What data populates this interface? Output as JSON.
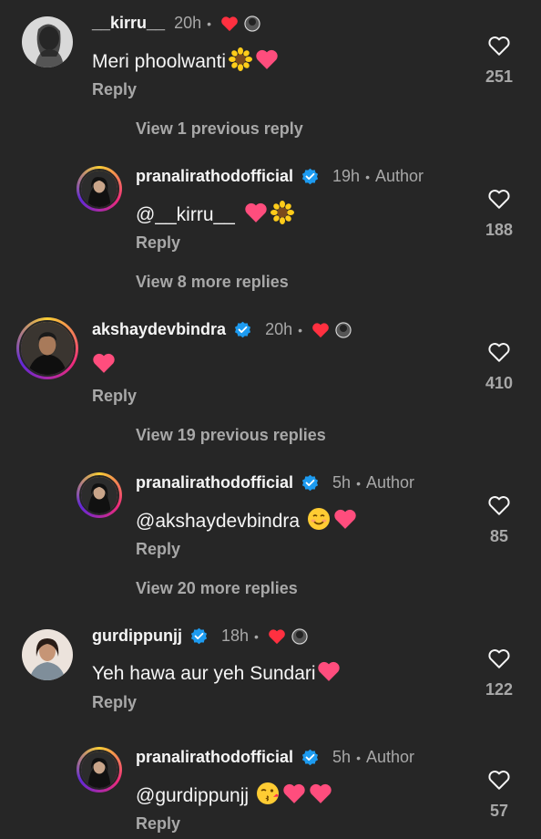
{
  "comments": [
    {
      "username": "__kirru__",
      "time": "20h",
      "text": "Meri phoolwanti",
      "emojis": [
        "sunflower-emoji",
        "pink-heart-emoji"
      ],
      "reply": "Reply",
      "likes": "251",
      "liked_by_author": true
    },
    {
      "username": "pranalirathodofficial",
      "time": "19h",
      "author": "Author",
      "text": "@__kirru__",
      "emojis": [
        "pink-heart-emoji",
        "sunflower-emoji"
      ],
      "reply": "Reply",
      "likes": "188"
    },
    {
      "username": "akshaydevbindra",
      "time": "20h",
      "text": "",
      "emojis": [
        "pink-heart-emoji"
      ],
      "reply": "Reply",
      "likes": "410",
      "liked_by_author": true
    },
    {
      "username": "pranalirathodofficial",
      "time": "5h",
      "author": "Author",
      "text": "@akshaydevbindra",
      "emojis": [
        "smiling-face-emoji",
        "pink-heart-emoji"
      ],
      "reply": "Reply",
      "likes": "85"
    },
    {
      "username": "gurdippunjj",
      "time": "18h",
      "text": "Yeh hawa aur yeh Sundari",
      "emojis": [
        "pink-heart-emoji"
      ],
      "reply": "Reply",
      "likes": "122",
      "liked_by_author": true
    },
    {
      "username": "pranalirathodofficial",
      "time": "5h",
      "author": "Author",
      "text": "@gurdippunjj",
      "emojis": [
        "kissing-face-emoji",
        "pink-heart-emoji",
        "pink-heart-emoji"
      ],
      "reply": "Reply",
      "likes": "57"
    }
  ],
  "view_more": [
    "View 1 previous reply",
    "View 8 more replies",
    "View 19 previous replies",
    "View 20 more replies"
  ],
  "separator": "•",
  "colors": {
    "background": "#262626",
    "primary_text": "#f5f5f5",
    "secondary_text": "#a8a8a8",
    "verified_badge": "#1d9bf0",
    "like_heart": "#ff3040",
    "pink_heart": "#ff4d7d"
  }
}
